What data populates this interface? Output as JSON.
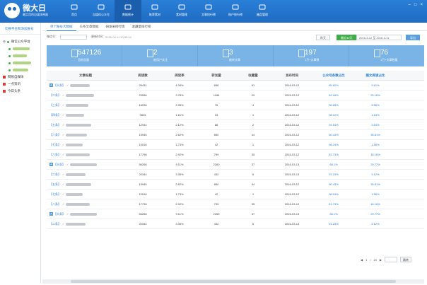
{
  "app": {
    "title": "微大日",
    "subtitle": "最实用的自媒体神器"
  },
  "nav": [
    "首页",
    "自媒体公众号",
    "数据统计",
    "推荐素材",
    "素材管理",
    "文章排行榜",
    "账户排行榜",
    "糖品管理"
  ],
  "nav_active": 2,
  "window_controls": [
    "–",
    "□",
    "×"
  ],
  "sidebar": {
    "header": "切换平台和添加账号",
    "group1": "微信公众平台",
    "group2": "网易自媒体",
    "group3": "一点资讯",
    "group4": "今日头条"
  },
  "tabs": [
    "单个账号大数据",
    "头条文章数据",
    "研发采榜行情",
    "收藏量排行榜"
  ],
  "filter": {
    "account_label": "微信号：",
    "update_label": "更新时间：",
    "update_time": "2016-04-11 10:59:44",
    "btn_yesterday": "昨天",
    "btn_recent30": "最近30天",
    "date_range": "2016-3-12 至 2016-4-11",
    "btn_export": "导出"
  },
  "stats": [
    {
      "value": "547126",
      "label": "总粉丝量",
      "icon": "user-icon"
    },
    {
      "value": "2",
      "label": "被用户关注",
      "icon": "doc-icon"
    },
    {
      "value": "3",
      "label": "被转文章",
      "icon": "share-icon"
    },
    {
      "value": "197",
      "label": "1万+文章数",
      "icon": "doc-icon"
    },
    {
      "value": "76",
      "label": "1万+文章数量",
      "icon": "doc-icon"
    }
  ],
  "table": {
    "headers": [
      "文章标题",
      "阅读数",
      "阅读率",
      "转发量",
      "收藏量",
      "发布时间",
      "公众号条数占比",
      "图文阅读占比"
    ],
    "rows": [
      {
        "tag": "【头条】",
        "pinned": true,
        "reads": "26431",
        "rate": "4.34%",
        "forward": "656",
        "fav": "61",
        "date": "2016-03-12",
        "p1": "65.62%",
        "p2": "9.61%"
      },
      {
        "tag": "【二条】",
        "pinned": false,
        "reads": "23056",
        "rate": "3.78%",
        "forward": "1186",
        "fav": "29",
        "date": "2016-03-12",
        "p1": "69.18%",
        "p2": "25.16%"
      },
      {
        "tag": "【三条】",
        "pinned": false,
        "reads": "16296",
        "rate": "2.35%",
        "forward": "76",
        "fav": "4",
        "date": "2016-03-12",
        "p1": "96.65%",
        "p2": "3.56%"
      },
      {
        "tag": "【四条】",
        "pinned": false,
        "reads": "9826",
        "rate": "1.61%",
        "forward": "33",
        "fav": "1",
        "date": "2016-03-12",
        "p1": "98.12%",
        "p2": "1.64%"
      },
      {
        "tag": "【五条】",
        "pinned": false,
        "reads": "12944",
        "rate": "2.12%",
        "forward": "88",
        "fav": "2",
        "date": "2016-03-12",
        "p1": "94.54%",
        "p2": "3.64%"
      },
      {
        "tag": "【六条】",
        "pinned": false,
        "reads": "15945",
        "rate": "2.62%",
        "forward": "850",
        "fav": "44",
        "date": "2016-03-12",
        "p1": "60.43%",
        "p2": "35.81%"
      },
      {
        "tag": "【七条】",
        "pinned": false,
        "reads": "10516",
        "rate": "1.73%",
        "forward": "42",
        "fav": "1",
        "date": "2016-03-12",
        "p1": "98.19%",
        "p2": "1.56%"
      },
      {
        "tag": "【八条】",
        "pinned": false,
        "reads": "17798",
        "rate": "2.92%",
        "forward": "799",
        "fav": "35",
        "date": "2016-03-12",
        "p1": "81.73%",
        "p2": "16.16%"
      },
      {
        "tag": "【头条】",
        "pinned": true,
        "reads": "56268",
        "rate": "9.11%",
        "forward": "2260",
        "fav": "37",
        "date": "2016-03-13",
        "p1": "68.1%",
        "p2": "29.77%"
      },
      {
        "tag": "【二条】",
        "pinned": false,
        "reads": "20344",
        "rate": "3.35%",
        "forward": "432",
        "fav": "6",
        "date": "2016-03-13",
        "p1": "91.23%",
        "p2": "3.12%"
      },
      {
        "tag": "【五条】",
        "pinned": false,
        "reads": "15945",
        "rate": "2.62%",
        "forward": "850",
        "fav": "44",
        "date": "2016-03-12",
        "p1": "60.43%",
        "p2": "35.81%"
      },
      {
        "tag": "【七条】",
        "pinned": false,
        "reads": "10516",
        "rate": "1.73%",
        "forward": "42",
        "fav": "1",
        "date": "2016-03-12",
        "p1": "96.19%",
        "p2": "1.56%"
      },
      {
        "tag": "【八条】",
        "pinned": false,
        "reads": "17798",
        "rate": "2.92%",
        "forward": "799",
        "fav": "35",
        "date": "2016-03-12",
        "p1": "81.73%",
        "p2": "16.16%"
      },
      {
        "tag": "【头条】",
        "pinned": true,
        "reads": "56268",
        "rate": "9.11%",
        "forward": "2260",
        "fav": "37",
        "date": "2016-03-13",
        "p1": "68.1%",
        "p2": "29.77%"
      },
      {
        "tag": "【二条】",
        "pinned": false,
        "reads": "20344",
        "rate": "3.35%",
        "forward": "432",
        "fav": "6",
        "date": "2016-03-13",
        "p1": "91.23%",
        "p2": "3.12%"
      }
    ]
  },
  "pager": {
    "prev": "◀",
    "current": "1",
    "separator": "/",
    "total": "24",
    "next": "▶",
    "go": "跳转"
  }
}
